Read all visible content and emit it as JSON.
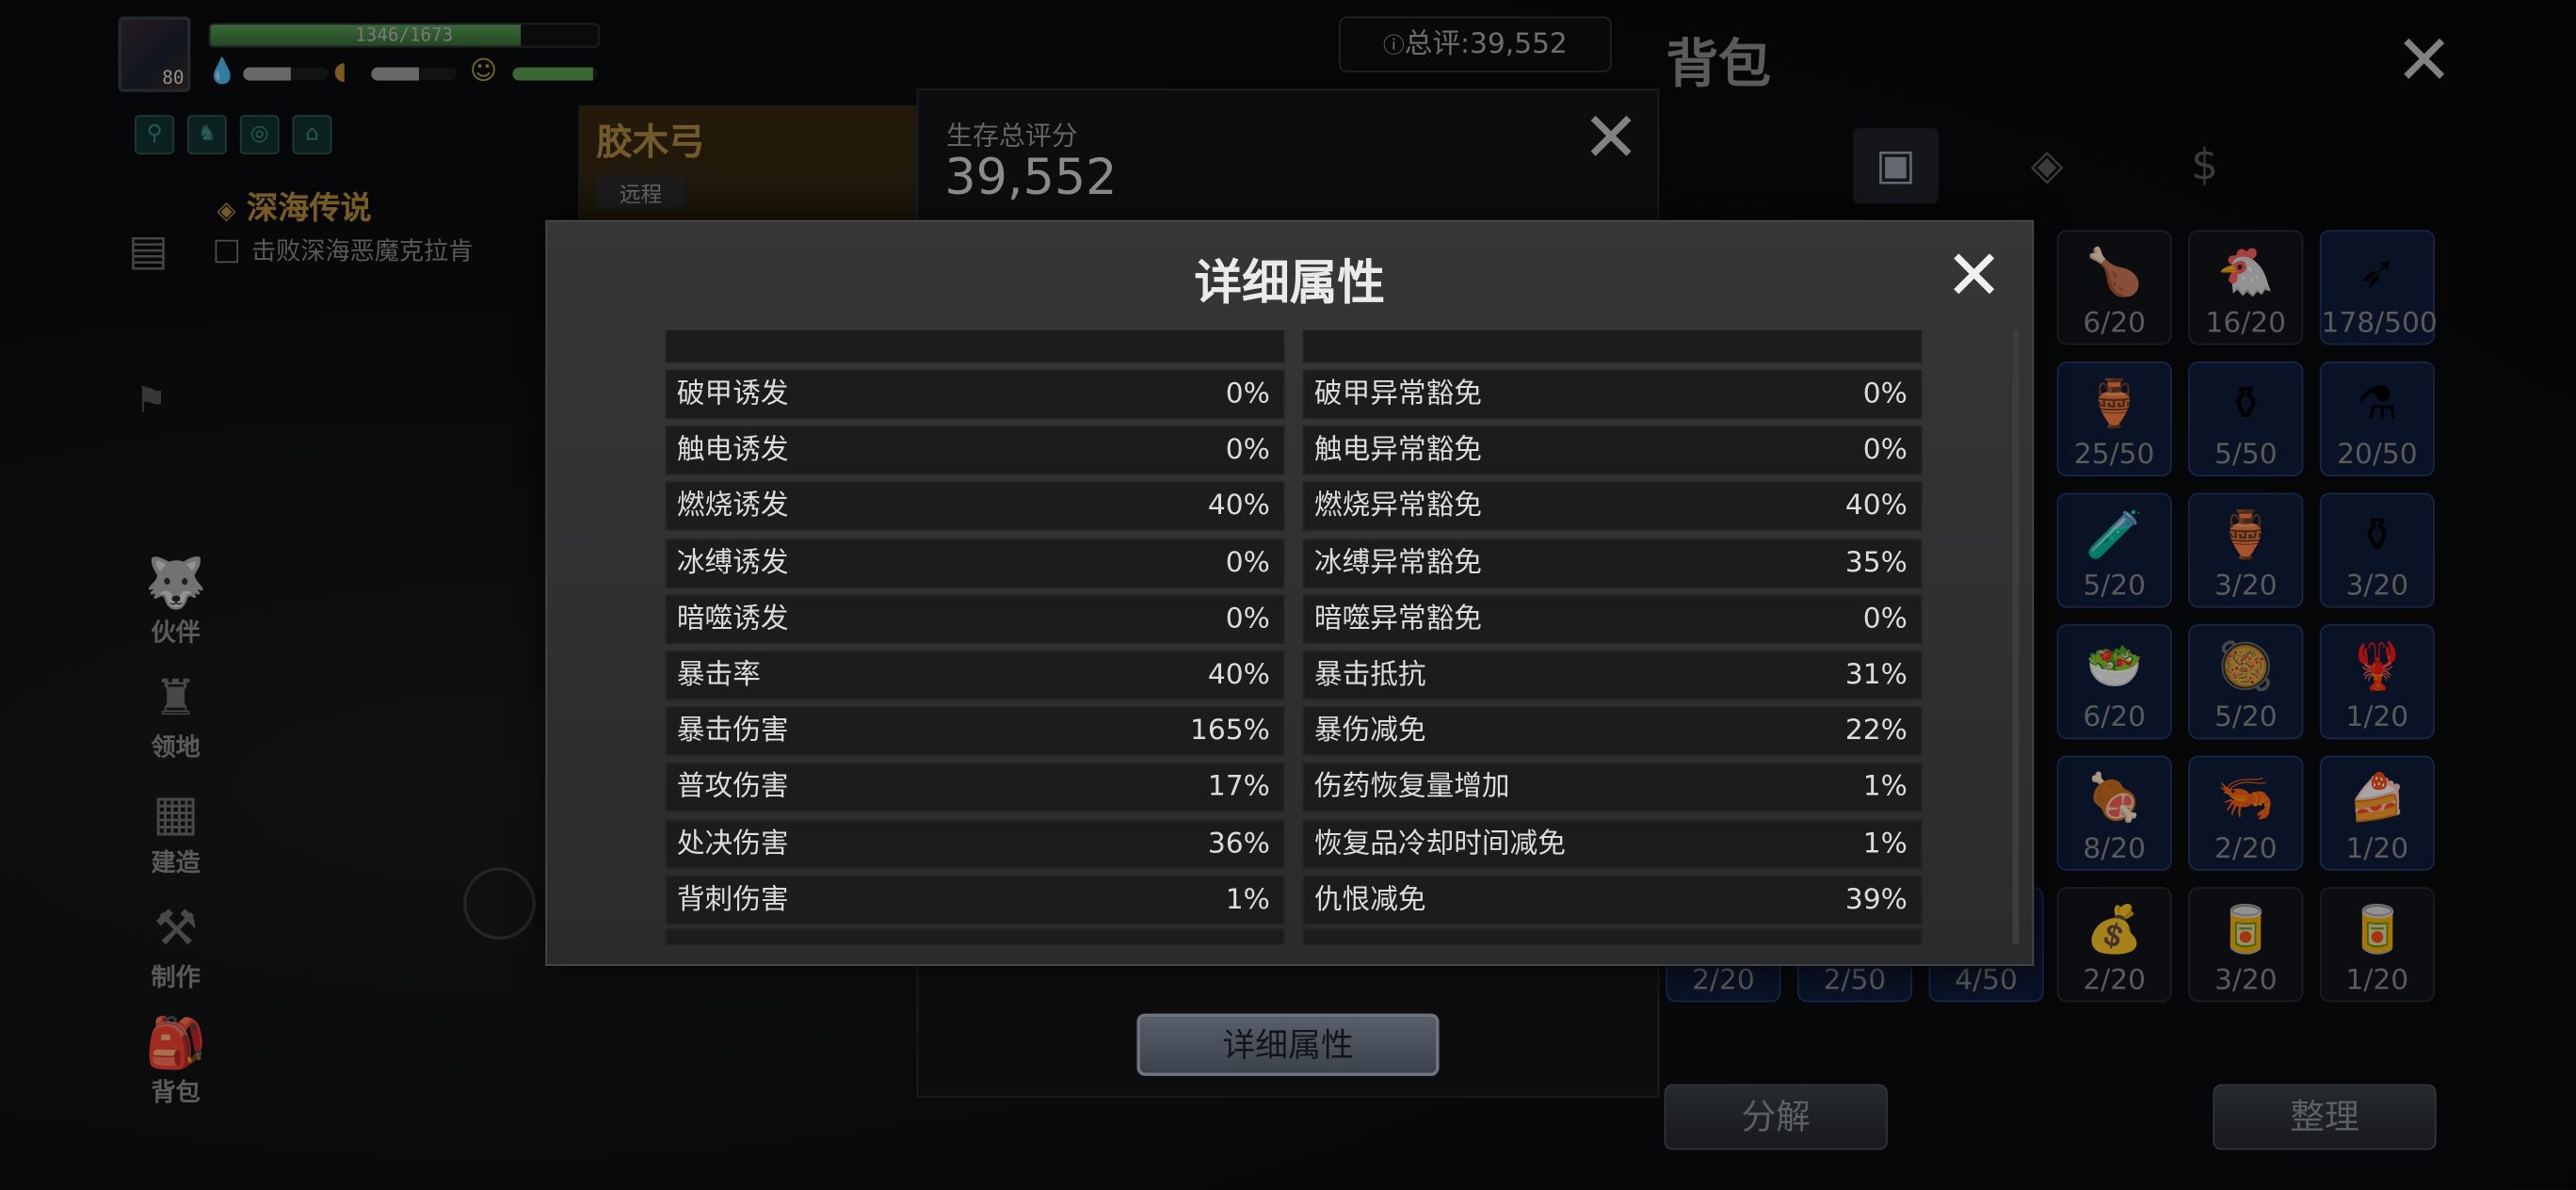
{
  "hud": {
    "level": "80",
    "hp_text": "1346/1673",
    "hp_fraction": 0.8,
    "status_bars": [
      0.55,
      0.55,
      0.95
    ],
    "quest_title": "深海传说",
    "quest_item": "击败深海恶魔克拉肯"
  },
  "side_menu": [
    "伙伴",
    "领地",
    "建造",
    "制作",
    "背包"
  ],
  "total_score": "总评:39,552",
  "weapon": {
    "name": "胶木弓",
    "type": "远程"
  },
  "score_panel": {
    "label": "生存总评分",
    "value": "39,552",
    "detail_button": "详细属性"
  },
  "backpack": {
    "title": "背包",
    "tabs": [
      "chest-icon",
      "compass-icon",
      "coin-icon"
    ],
    "rows": [
      [
        "6/20",
        "16/20",
        "178/500"
      ],
      [
        "25/50",
        "5/50",
        "20/50"
      ],
      [
        "5/20",
        "3/20",
        "3/20"
      ],
      [
        "6/20",
        "5/20",
        "1/20"
      ],
      [
        "8/20",
        "2/20",
        "1/20"
      ],
      [
        "2/20",
        "3/20",
        "1/20"
      ]
    ],
    "bottom_counts": [
      "2/20",
      "2/50",
      "4/50"
    ],
    "decompose_button": "分解",
    "sort_button": "整理"
  },
  "modal": {
    "title": "详细属性",
    "rows": [
      {
        "left_label": "破甲诱发",
        "left_value": "0%",
        "right_label": "破甲异常豁免",
        "right_value": "0%"
      },
      {
        "left_label": "触电诱发",
        "left_value": "0%",
        "right_label": "触电异常豁免",
        "right_value": "0%"
      },
      {
        "left_label": "燃烧诱发",
        "left_value": "40%",
        "right_label": "燃烧异常豁免",
        "right_value": "40%"
      },
      {
        "left_label": "冰缚诱发",
        "left_value": "0%",
        "right_label": "冰缚异常豁免",
        "right_value": "35%"
      },
      {
        "left_label": "暗噬诱发",
        "left_value": "0%",
        "right_label": "暗噬异常豁免",
        "right_value": "0%"
      },
      {
        "left_label": "暴击率",
        "left_value": "40%",
        "right_label": "暴击抵抗",
        "right_value": "31%"
      },
      {
        "left_label": "暴击伤害",
        "left_value": "165%",
        "right_label": "暴伤减免",
        "right_value": "22%"
      },
      {
        "left_label": "普攻伤害",
        "left_value": "17%",
        "right_label": "伤药恢复量增加",
        "right_value": "1%"
      },
      {
        "left_label": "处决伤害",
        "left_value": "36%",
        "right_label": "恢复品冷却时间减免",
        "right_value": "1%"
      },
      {
        "left_label": "背刺伤害",
        "left_value": "1%",
        "right_label": "仇恨减免",
        "right_value": "39%"
      }
    ]
  }
}
